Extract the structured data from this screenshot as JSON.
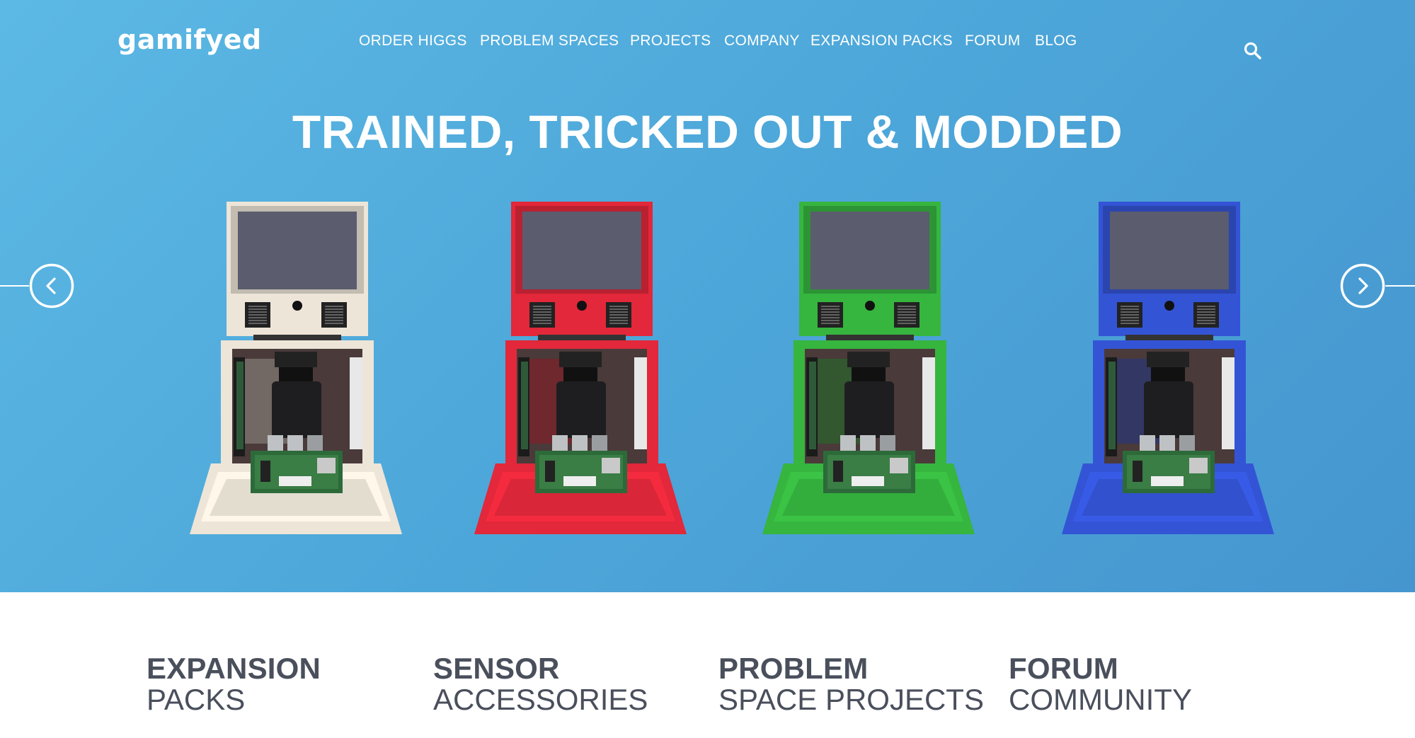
{
  "header": {
    "logo_text": "gamifyed",
    "nav": [
      "ORDER HIGGS",
      "PROBLEM SPACES",
      "PROJECTS",
      "COMPANY",
      "EXPANSION PACKS",
      "FORUM",
      "BLOG"
    ],
    "search_icon": "search-icon"
  },
  "hero": {
    "headline": "TRAINED, TRICKED OUT & MODDED",
    "kiosks": [
      {
        "color_name": "cream",
        "color": "#ede5d8"
      },
      {
        "color_name": "red",
        "color": "#e2283a"
      },
      {
        "color_name": "green",
        "color": "#36b53f"
      },
      {
        "color_name": "blue",
        "color": "#3454d6"
      }
    ],
    "prev_icon": "chevron-left-icon",
    "next_icon": "chevron-right-icon"
  },
  "features": [
    {
      "line1": "EXPANSION",
      "line2": "PACKS"
    },
    {
      "line1": "SENSOR",
      "line2": "ACCESSORIES"
    },
    {
      "line1": "PROBLEM",
      "line2": "SPACE PROJECTS"
    },
    {
      "line1": "FORUM",
      "line2": "COMMUNITY"
    }
  ],
  "colors": {
    "hero_blue": "#4ea8da",
    "white": "#ffffff",
    "text_dark": "#4a4f5c"
  }
}
